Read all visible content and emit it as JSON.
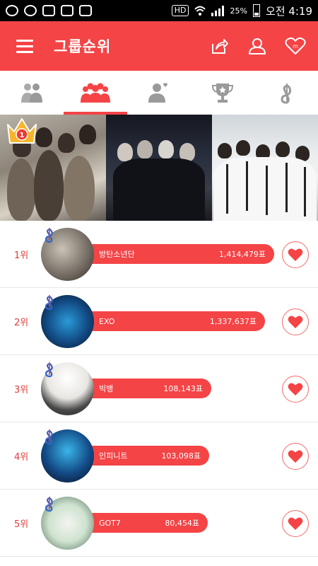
{
  "status_bar": {
    "network_badge": "HD",
    "battery": "25%",
    "time": "오전 4:19"
  },
  "app_bar": {
    "title": "그룹순위",
    "menu_icon": "hamburger-icon",
    "actions": [
      "share-icon",
      "profile-icon",
      "heart-m-icon"
    ]
  },
  "tabs": [
    {
      "icon": "duo-icon",
      "active": false
    },
    {
      "icon": "group-icon",
      "active": true
    },
    {
      "icon": "solo-icon",
      "active": false
    },
    {
      "icon": "trophy-icon",
      "active": false
    },
    {
      "icon": "music-note-icon",
      "active": false
    }
  ],
  "banner": {
    "badge": "1"
  },
  "rankings": [
    {
      "rank": "1위",
      "name": "방탄소년단",
      "votes": "1,414,479표",
      "fill": 1.0
    },
    {
      "rank": "2위",
      "name": "EXO",
      "votes": "1,337,637표",
      "fill": 0.95
    },
    {
      "rank": "3위",
      "name": "빅뱅",
      "votes": "108,143표",
      "fill": 0.67
    },
    {
      "rank": "4위",
      "name": "인피니트",
      "votes": "103,098표",
      "fill": 0.66
    },
    {
      "rank": "5위",
      "name": "GOT7",
      "votes": "80,454표",
      "fill": 0.65
    }
  ],
  "colors": {
    "accent": "#f44446",
    "rank_text": "#e23c3c"
  }
}
